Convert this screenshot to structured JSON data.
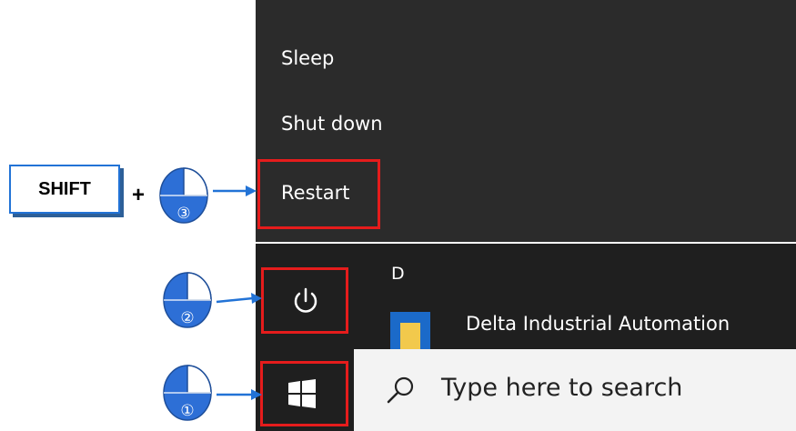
{
  "power_menu": {
    "items": [
      {
        "label": "Sleep"
      },
      {
        "label": "Shut down"
      },
      {
        "label": "Restart"
      }
    ]
  },
  "apps": {
    "section_letter": "D",
    "app_label": "Delta Industrial Automation"
  },
  "taskbar": {
    "start_icon": "windows-logo",
    "search_placeholder": "Type here to search",
    "search_icon": "search-icon"
  },
  "annotations": {
    "shift_key": "SHIFT",
    "plus": "+",
    "steps": [
      {
        "number": "①",
        "target": "start-button"
      },
      {
        "number": "②",
        "target": "power-button"
      },
      {
        "number": "③",
        "target": "restart-item"
      }
    ],
    "colors": {
      "highlight": "#e51c1c",
      "arrow": "#2273d6"
    }
  }
}
